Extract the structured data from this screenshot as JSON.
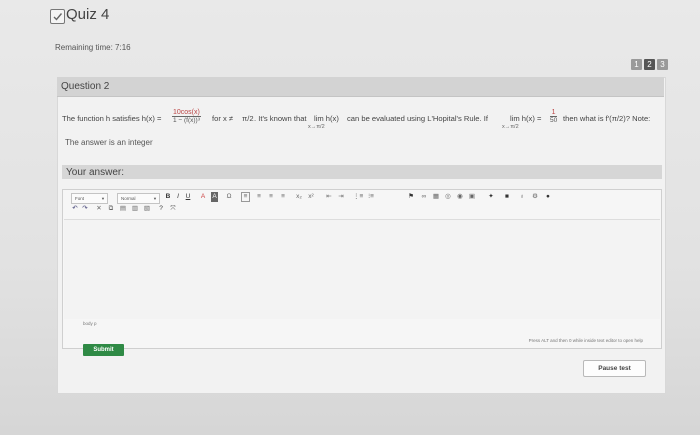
{
  "header": {
    "title": "Quiz 4",
    "remaining_time": "Remaining time: 7:16"
  },
  "question_nav": [
    "1",
    "2",
    "3"
  ],
  "question": {
    "label": "Question 2",
    "statement": {
      "intro": "The function h satisfies h(x) =",
      "frac_num": "10cos(x)",
      "frac_den": "1 − (f(x))³",
      "cond": "for x ≠",
      "pi_half": "π/2",
      "middle": ". It's known that",
      "lim": "lim h(x)",
      "lim_sub": "x→π/2",
      "rule": "can be evaluated using L'Hopital's Rule. If",
      "lim2": "lim h(x) =",
      "frac2_num": "1",
      "frac2_den": "50",
      "tail": "then what is f′(π/2)? Note:"
    },
    "note": "The answer is an integer"
  },
  "answer": {
    "label": "Your answer:",
    "font_select": "Font",
    "size_select": "Normal",
    "path": "body  p",
    "hint": "Press ALT and then 0 while inside text editor to open help"
  },
  "buttons": {
    "submit": "Submit",
    "pause": "Pause test"
  },
  "toolbar": {
    "bold": "B",
    "italic": "I",
    "underline": "U",
    "text_color": "A",
    "bg_color": "A",
    "omega": "Ω",
    "sub": "x₂",
    "sup": "x²",
    "undo": "↶",
    "redo": "↷",
    "cut": "✕",
    "help": "?",
    "full": "⤧"
  },
  "colors": {
    "submit": "#2f8a45",
    "nav_active": "#555555"
  }
}
